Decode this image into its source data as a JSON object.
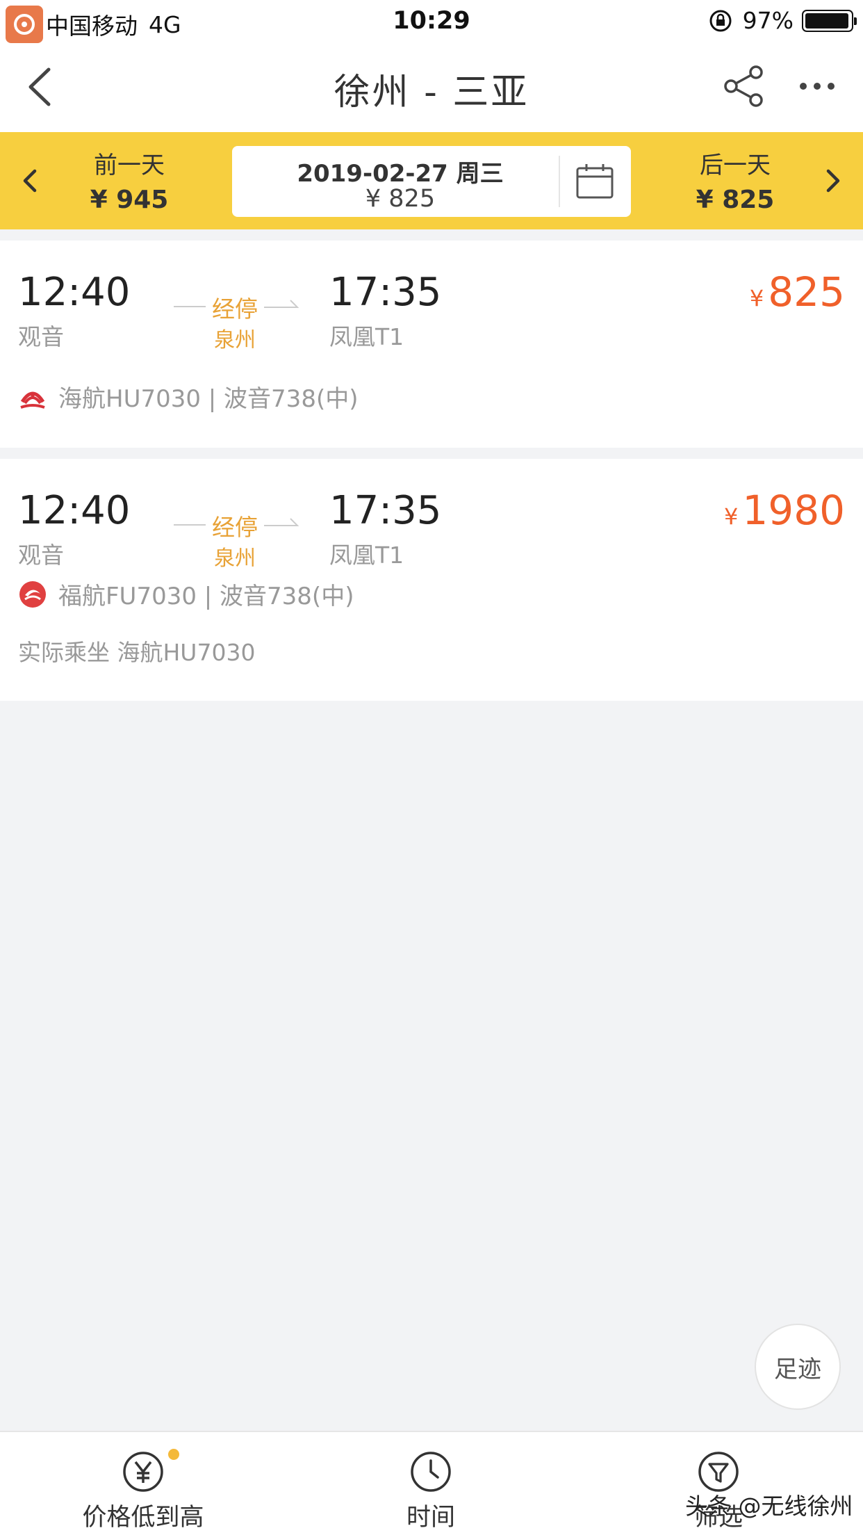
{
  "status_bar": {
    "carrier": "中国移动",
    "network": "4G",
    "time": "10:29",
    "battery": "97%",
    "battery_level": 0.97
  },
  "nav": {
    "title": "徐州 - 三亚",
    "back_icon": "chevron-left-icon",
    "share_icon": "share-icon",
    "more_icon": "more-dots-icon"
  },
  "date_bar": {
    "prev": {
      "label": "前一天",
      "price": "¥ 945"
    },
    "current": {
      "date": "2019-02-27 周三",
      "price": "¥ 825"
    },
    "next": {
      "label": "后一天",
      "price": "¥ 825"
    },
    "calendar_icon": "calendar-icon"
  },
  "flights": [
    {
      "dep_time": "12:40",
      "dep_airport": "观音",
      "stop_label": "经停",
      "stop_city": "泉州",
      "arr_time": "17:35",
      "arr_airport": "凤凰T1",
      "currency": "¥",
      "price": "825",
      "airline_info": "海航HU7030 | 波音738(中)"
    },
    {
      "dep_time": "12:40",
      "dep_airport": "观音",
      "stop_label": "经停",
      "stop_city": "泉州",
      "arr_time": "17:35",
      "arr_airport": "凤凰T1",
      "currency": "¥",
      "price": "1980",
      "airline_info": "福航FU7030 | 波音738(中)",
      "codeshare": "实际乘坐 海航HU7030"
    }
  ],
  "footprint": "足迹",
  "tabs": {
    "price": "价格低到高",
    "time": "时间",
    "filter": "筛选"
  },
  "watermark": "头条 @无线徐州",
  "colors": {
    "accent_yellow": "#f7cf3f",
    "price_orange": "#f0602a",
    "stop_amber": "#e8a236"
  }
}
